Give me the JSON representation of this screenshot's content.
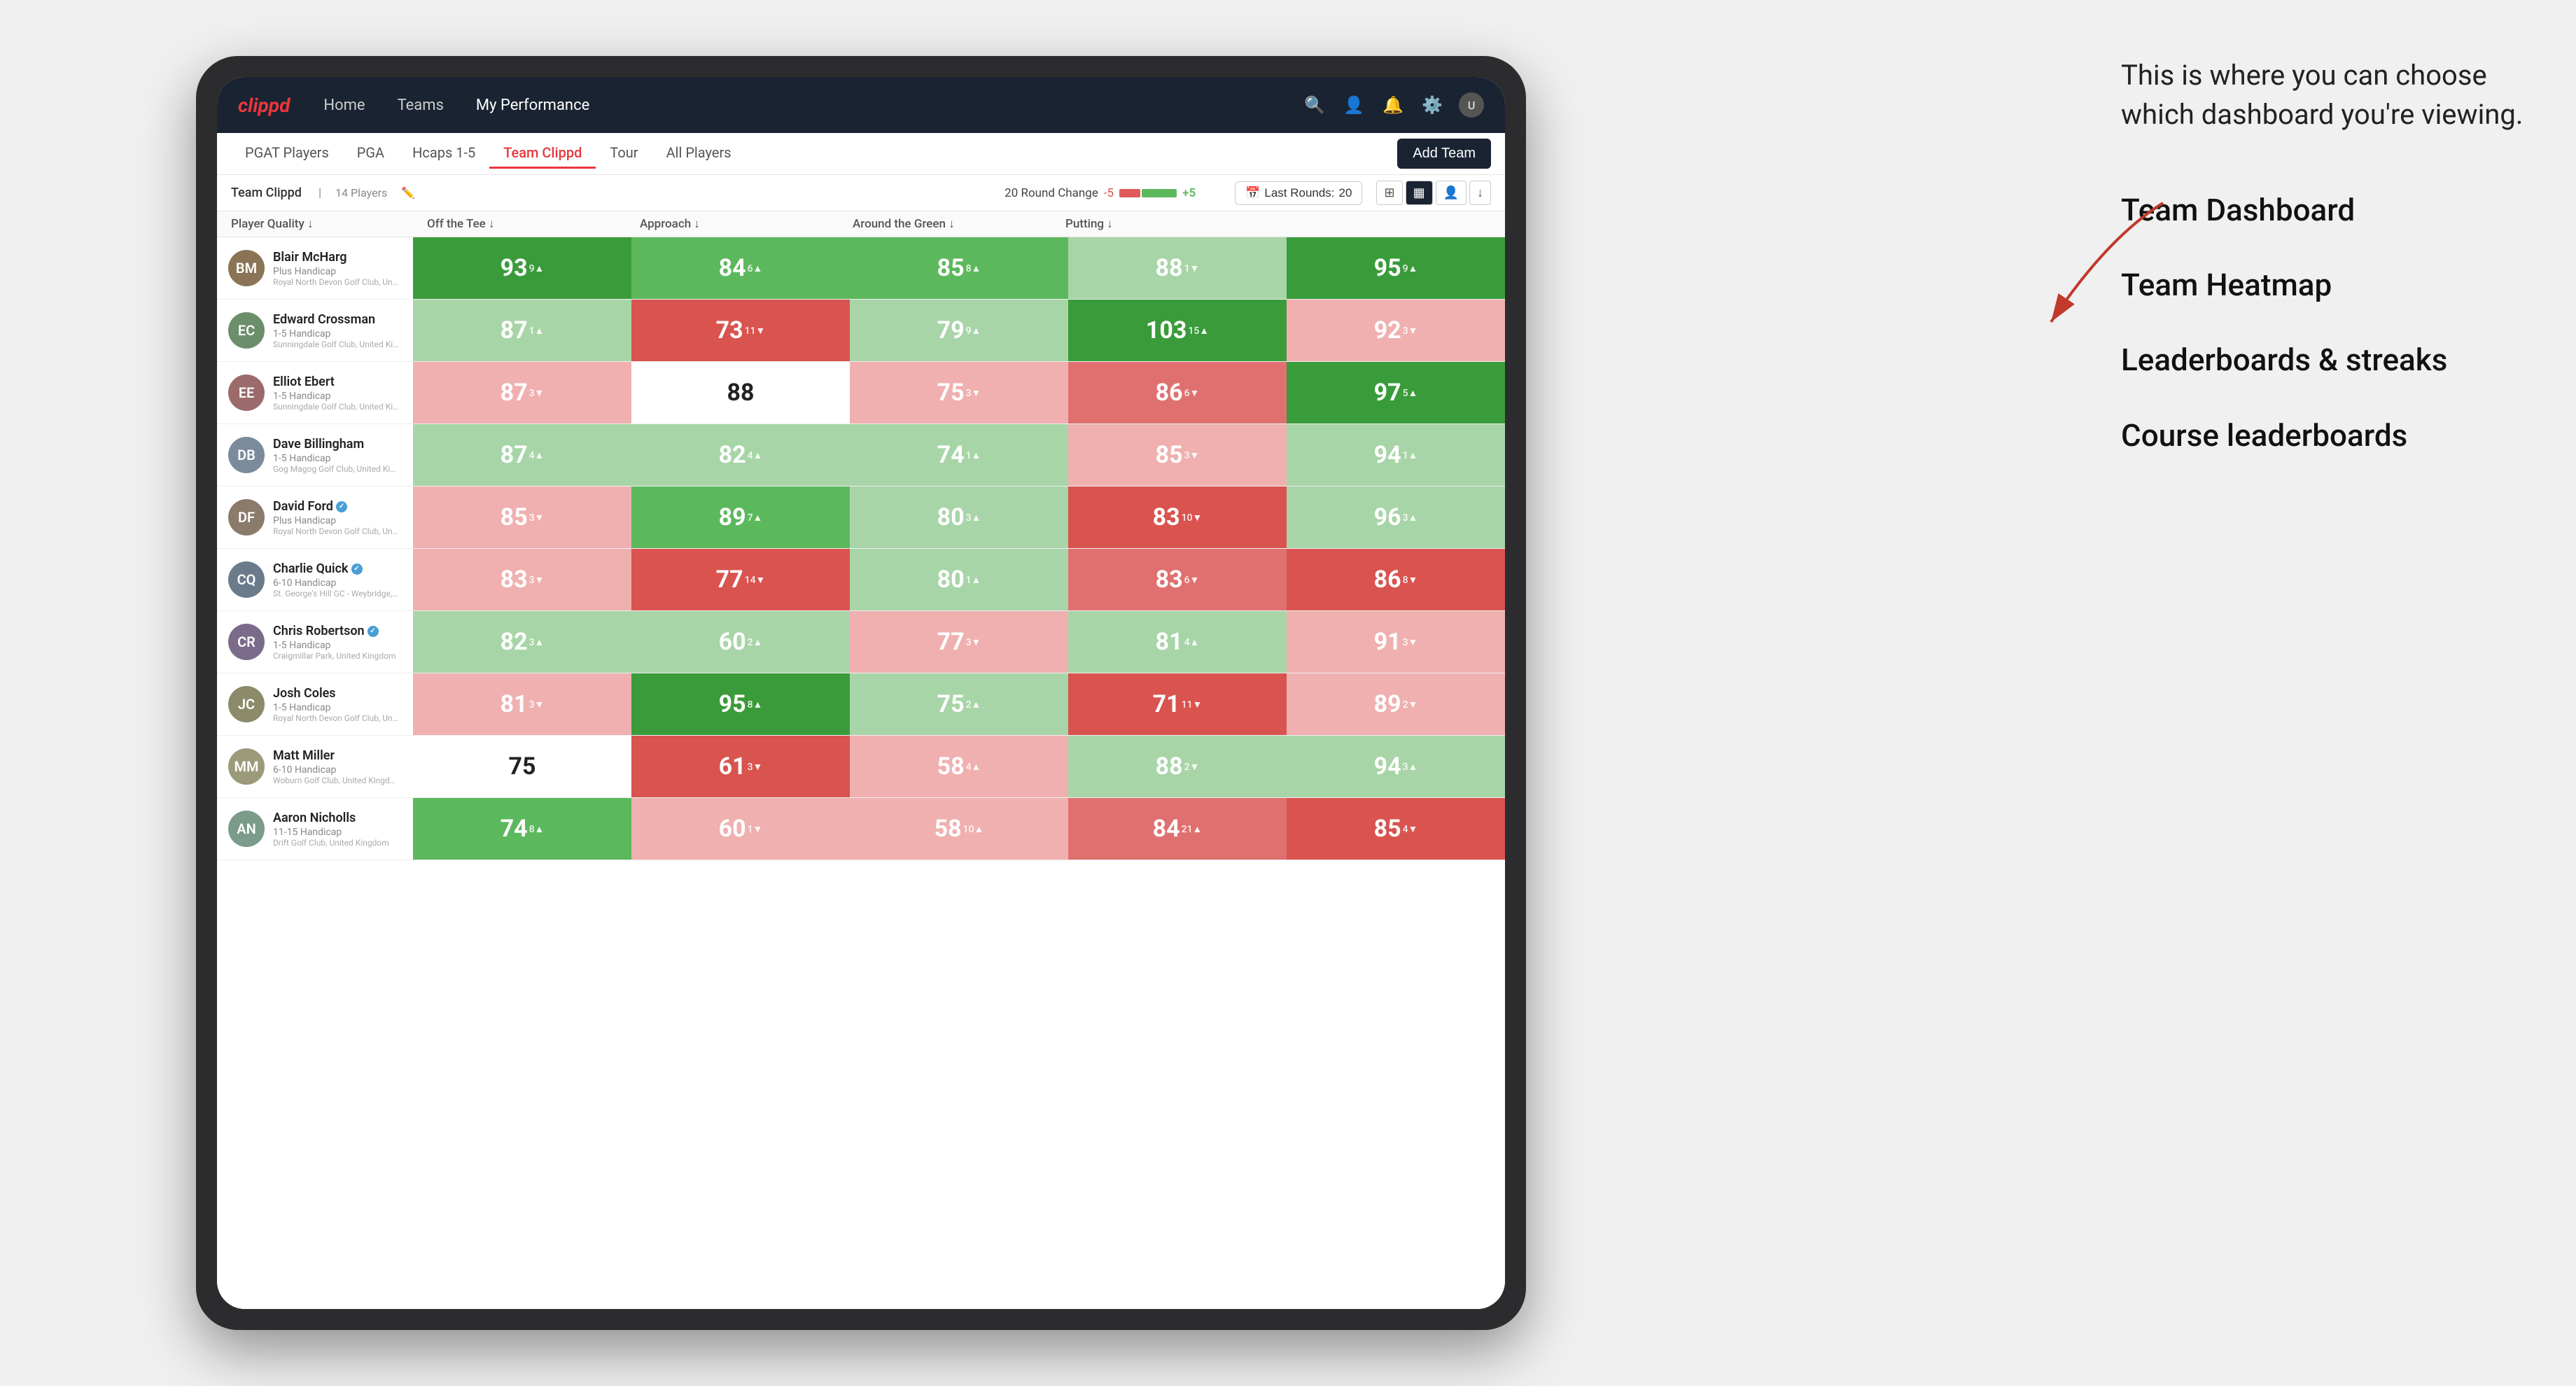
{
  "annotation": {
    "text": "This is where you can choose which dashboard you're viewing.",
    "options": [
      "Team Dashboard",
      "Team Heatmap",
      "Leaderboards & streaks",
      "Course leaderboards"
    ]
  },
  "nav": {
    "logo": "clippd",
    "items": [
      "Home",
      "Teams",
      "My Performance"
    ],
    "active": "My Performance"
  },
  "tabs": {
    "items": [
      "PGAT Players",
      "PGA",
      "Hcaps 1-5",
      "Team Clippd",
      "Tour",
      "All Players"
    ],
    "active": "Team Clippd",
    "add_button": "Add Team"
  },
  "subbar": {
    "team_label": "Team Clippd",
    "player_count": "14 Players",
    "round_change_label": "20 Round Change",
    "round_change_neg": "-5",
    "round_change_pos": "+5",
    "last_rounds_label": "Last Rounds:",
    "last_rounds_val": "20"
  },
  "table": {
    "columns": [
      "Player Quality ↓",
      "Off the Tee ↓",
      "Approach ↓",
      "Around the Green ↓",
      "Putting ↓"
    ],
    "rows": [
      {
        "name": "Blair McHarg",
        "hcap": "Plus Handicap",
        "club": "Royal North Devon Golf Club, United Kingdom",
        "avatar_initials": "BM",
        "avatar_color": "#8B7355",
        "scores": [
          {
            "val": "93",
            "change": "9▲",
            "dir": "up",
            "bg": "bg-green-dark"
          },
          {
            "val": "84",
            "change": "6▲",
            "dir": "up",
            "bg": "bg-green-mid"
          },
          {
            "val": "85",
            "change": "8▲",
            "dir": "up",
            "bg": "bg-green-mid"
          },
          {
            "val": "88",
            "change": "1▼",
            "dir": "down",
            "bg": "bg-green-light"
          },
          {
            "val": "95",
            "change": "9▲",
            "dir": "up",
            "bg": "bg-green-dark"
          }
        ]
      },
      {
        "name": "Edward Crossman",
        "hcap": "1-5 Handicap",
        "club": "Sunningdale Golf Club, United Kingdom",
        "avatar_initials": "EC",
        "avatar_color": "#6B8E6B",
        "scores": [
          {
            "val": "87",
            "change": "1▲",
            "dir": "up",
            "bg": "bg-green-light"
          },
          {
            "val": "73",
            "change": "11▼",
            "dir": "down",
            "bg": "bg-red-dark"
          },
          {
            "val": "79",
            "change": "9▲",
            "dir": "up",
            "bg": "bg-green-light"
          },
          {
            "val": "103",
            "change": "15▲",
            "dir": "up",
            "bg": "bg-green-dark"
          },
          {
            "val": "92",
            "change": "3▼",
            "dir": "down",
            "bg": "bg-red-light"
          }
        ]
      },
      {
        "name": "Elliot Ebert",
        "hcap": "1-5 Handicap",
        "club": "Sunningdale Golf Club, United Kingdom",
        "avatar_initials": "EE",
        "avatar_color": "#9B6B6B",
        "scores": [
          {
            "val": "87",
            "change": "3▼",
            "dir": "down",
            "bg": "bg-red-light"
          },
          {
            "val": "88",
            "change": "",
            "dir": "none",
            "bg": "bg-white"
          },
          {
            "val": "75",
            "change": "3▼",
            "dir": "down",
            "bg": "bg-red-light"
          },
          {
            "val": "86",
            "change": "6▼",
            "dir": "down",
            "bg": "bg-red-mid"
          },
          {
            "val": "97",
            "change": "5▲",
            "dir": "up",
            "bg": "bg-green-dark"
          }
        ]
      },
      {
        "name": "Dave Billingham",
        "hcap": "1-5 Handicap",
        "club": "Gog Magog Golf Club, United Kingdom",
        "avatar_initials": "DB",
        "avatar_color": "#7B8B9B",
        "scores": [
          {
            "val": "87",
            "change": "4▲",
            "dir": "up",
            "bg": "bg-green-light"
          },
          {
            "val": "82",
            "change": "4▲",
            "dir": "up",
            "bg": "bg-green-light"
          },
          {
            "val": "74",
            "change": "1▲",
            "dir": "up",
            "bg": "bg-green-light"
          },
          {
            "val": "85",
            "change": "3▼",
            "dir": "down",
            "bg": "bg-red-light"
          },
          {
            "val": "94",
            "change": "1▲",
            "dir": "up",
            "bg": "bg-green-light"
          }
        ]
      },
      {
        "name": "David Ford",
        "hcap": "Plus Handicap",
        "club": "Royal North Devon Golf Club, United Kingdom",
        "avatar_initials": "DF",
        "avatar_color": "#8B7B6B",
        "verified": true,
        "scores": [
          {
            "val": "85",
            "change": "3▼",
            "dir": "down",
            "bg": "bg-red-light"
          },
          {
            "val": "89",
            "change": "7▲",
            "dir": "up",
            "bg": "bg-green-mid"
          },
          {
            "val": "80",
            "change": "3▲",
            "dir": "up",
            "bg": "bg-green-light"
          },
          {
            "val": "83",
            "change": "10▼",
            "dir": "down",
            "bg": "bg-red-dark"
          },
          {
            "val": "96",
            "change": "3▲",
            "dir": "up",
            "bg": "bg-green-light"
          }
        ]
      },
      {
        "name": "Charlie Quick",
        "hcap": "6-10 Handicap",
        "club": "St. George's Hill GC - Weybridge, Surrey, Uni...",
        "avatar_initials": "CQ",
        "avatar_color": "#6B7B8B",
        "verified": true,
        "scores": [
          {
            "val": "83",
            "change": "3▼",
            "dir": "down",
            "bg": "bg-red-light"
          },
          {
            "val": "77",
            "change": "14▼",
            "dir": "down",
            "bg": "bg-red-dark"
          },
          {
            "val": "80",
            "change": "1▲",
            "dir": "up",
            "bg": "bg-green-light"
          },
          {
            "val": "83",
            "change": "6▼",
            "dir": "down",
            "bg": "bg-red-mid"
          },
          {
            "val": "86",
            "change": "8▼",
            "dir": "down",
            "bg": "bg-red-dark"
          }
        ]
      },
      {
        "name": "Chris Robertson",
        "hcap": "1-5 Handicap",
        "club": "Craigmillar Park, United Kingdom",
        "avatar_initials": "CR",
        "avatar_color": "#7B6B8B",
        "verified": true,
        "scores": [
          {
            "val": "82",
            "change": "3▲",
            "dir": "up",
            "bg": "bg-green-light"
          },
          {
            "val": "60",
            "change": "2▲",
            "dir": "up",
            "bg": "bg-green-light"
          },
          {
            "val": "77",
            "change": "3▼",
            "dir": "down",
            "bg": "bg-red-light"
          },
          {
            "val": "81",
            "change": "4▲",
            "dir": "up",
            "bg": "bg-green-light"
          },
          {
            "val": "91",
            "change": "3▼",
            "dir": "down",
            "bg": "bg-red-light"
          }
        ]
      },
      {
        "name": "Josh Coles",
        "hcap": "1-5 Handicap",
        "club": "Royal North Devon Golf Club, United Kingdom",
        "avatar_initials": "JC",
        "avatar_color": "#8B8B6B",
        "scores": [
          {
            "val": "81",
            "change": "3▼",
            "dir": "down",
            "bg": "bg-red-light"
          },
          {
            "val": "95",
            "change": "8▲",
            "dir": "up",
            "bg": "bg-green-dark"
          },
          {
            "val": "75",
            "change": "2▲",
            "dir": "up",
            "bg": "bg-green-light"
          },
          {
            "val": "71",
            "change": "11▼",
            "dir": "down",
            "bg": "bg-red-dark"
          },
          {
            "val": "89",
            "change": "2▼",
            "dir": "down",
            "bg": "bg-red-light"
          }
        ]
      },
      {
        "name": "Matt Miller",
        "hcap": "6-10 Handicap",
        "club": "Woburn Golf Club, United Kingdom",
        "avatar_initials": "MM",
        "avatar_color": "#9B9B7B",
        "scores": [
          {
            "val": "75",
            "change": "",
            "dir": "none",
            "bg": "bg-white"
          },
          {
            "val": "61",
            "change": "3▼",
            "dir": "down",
            "bg": "bg-red-dark"
          },
          {
            "val": "58",
            "change": "4▲",
            "dir": "up",
            "bg": "bg-red-light"
          },
          {
            "val": "88",
            "change": "2▼",
            "dir": "down",
            "bg": "bg-green-light"
          },
          {
            "val": "94",
            "change": "3▲",
            "dir": "up",
            "bg": "bg-green-light"
          }
        ]
      },
      {
        "name": "Aaron Nicholls",
        "hcap": "11-15 Handicap",
        "club": "Drift Golf Club, United Kingdom",
        "avatar_initials": "AN",
        "avatar_color": "#7B9B8B",
        "scores": [
          {
            "val": "74",
            "change": "8▲",
            "dir": "up",
            "bg": "bg-green-mid"
          },
          {
            "val": "60",
            "change": "1▼",
            "dir": "down",
            "bg": "bg-red-light"
          },
          {
            "val": "58",
            "change": "10▲",
            "dir": "up",
            "bg": "bg-red-light"
          },
          {
            "val": "84",
            "change": "21▲",
            "dir": "up",
            "bg": "bg-red-mid"
          },
          {
            "val": "85",
            "change": "4▼",
            "dir": "down",
            "bg": "bg-red-dark"
          }
        ]
      }
    ]
  }
}
